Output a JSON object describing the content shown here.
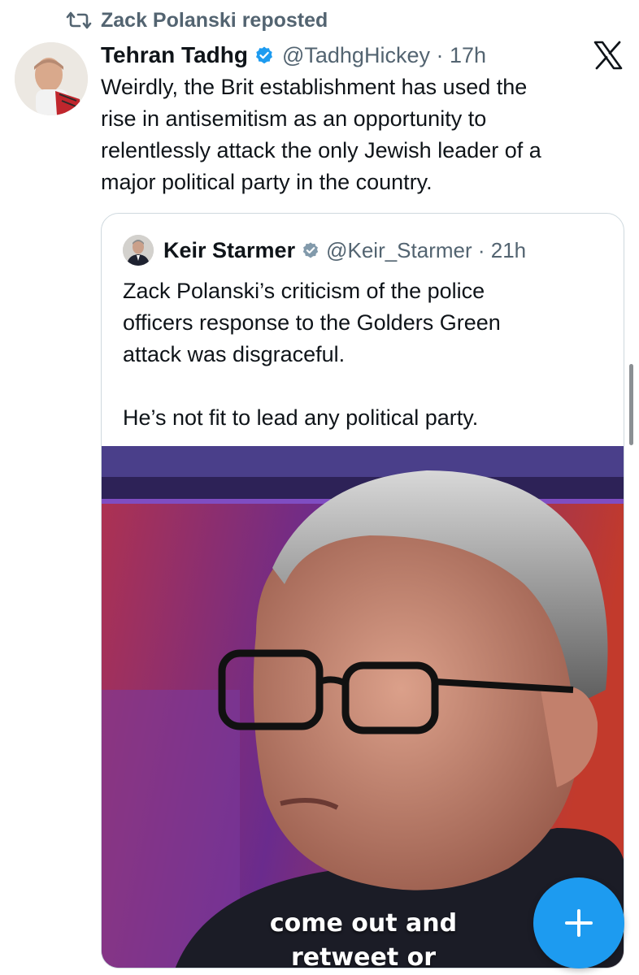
{
  "repost": {
    "text": "Zack Polanski reposted",
    "icon": "repost-icon"
  },
  "post": {
    "author_name": "Tehran Tadhg",
    "handle_time": "@TadhgHickey · 17h",
    "text_lines": [
      "Weirdly, the Brit establishment has used the",
      "rise in antisemitism as an opportunity to",
      "relentlessly attack the only Jewish leader of a",
      "major political party in the country."
    ]
  },
  "quoted": {
    "author_name": "Keir Starmer",
    "handle_time": "@Keir_Starmer · 21h",
    "text_lines": [
      "Zack Polanski’s criticism of the police",
      "officers response to the Golders Green",
      "attack was disgraceful."
    ],
    "text_line_2": "He’s not fit to lead any political party.",
    "video_caption_1": "come out and",
    "video_caption_2": "retweet or"
  },
  "colors": {
    "accent": "#1d9bf0",
    "secondary_text": "#536471",
    "border": "#cfd9de"
  }
}
